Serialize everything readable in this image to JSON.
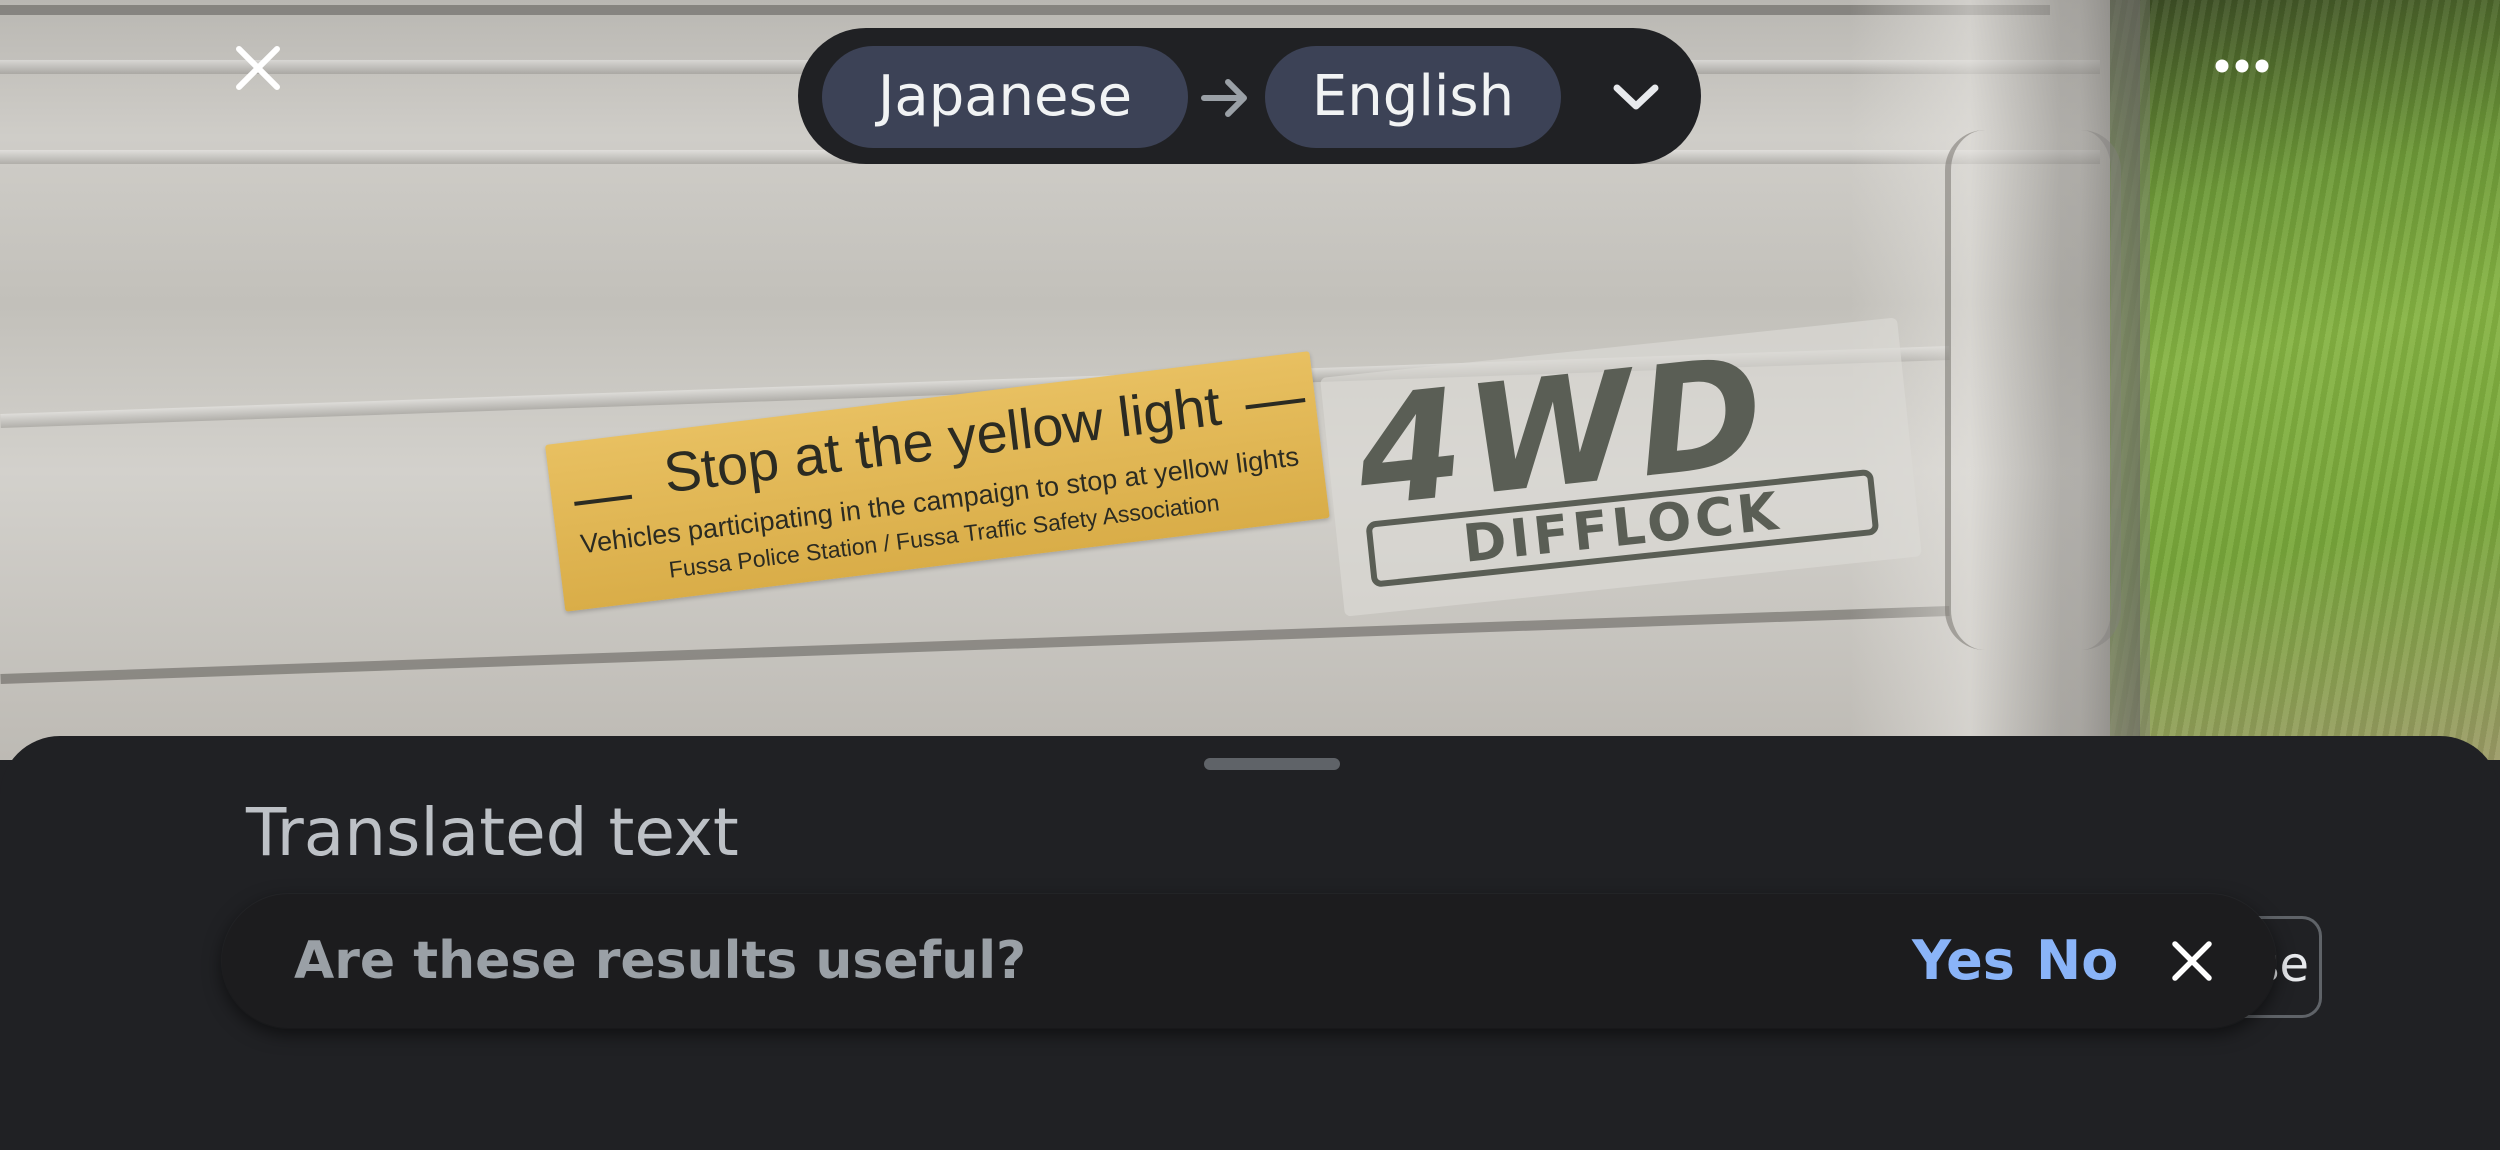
{
  "language_bar": {
    "source_language": "Japanese",
    "target_language": "English"
  },
  "translated_sticker": {
    "line1": "Stop at the yellow light",
    "line2": "Vehicles participating in the campaign to stop at yellow lights",
    "line3": "Fussa Police Station / Fussa Traffic Safety Association"
  },
  "decal": {
    "main": "4WD",
    "sub": "DIFFLOCK"
  },
  "bottom_sheet": {
    "title": "Translated text",
    "behind_button_fragment": "se"
  },
  "feedback": {
    "question": "Are these results useful?",
    "yes_label": "Yes",
    "no_label": "No"
  },
  "icons": {
    "close": "close-icon",
    "more": "more-horiz-icon",
    "arrow": "arrow-right-icon",
    "dropdown": "chevron-down-icon"
  },
  "colors": {
    "accent": "#8ab4f8",
    "chip": "#3c4256",
    "sheet": "#202124"
  }
}
